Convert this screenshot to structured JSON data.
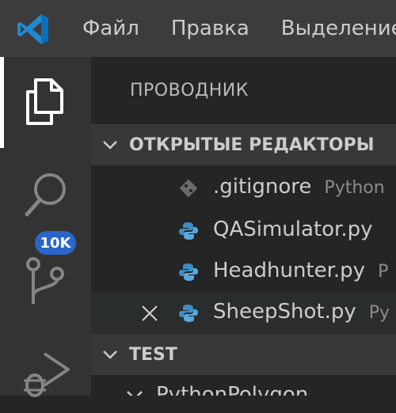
{
  "menu": [
    "Файл",
    "Правка",
    "Выделение"
  ],
  "activity": {
    "items": [
      "explorer-icon",
      "search-icon",
      "source-control-icon",
      "run-debug-icon"
    ],
    "scm_badge": "10K"
  },
  "explorer": {
    "title": "ПРОВОДНИК",
    "open_editors": {
      "label": "ОТКРЫТЫЕ РЕДАКТОРЫ",
      "files": [
        {
          "name": ".gitignore",
          "path": "Python",
          "icon": "git-file-icon"
        },
        {
          "name": "QASimulator.py",
          "path": "",
          "icon": "python-file-icon"
        },
        {
          "name": "Headhunter.py",
          "path": "P",
          "icon": "python-file-icon"
        },
        {
          "name": "SheepShot.py",
          "path": "Py",
          "icon": "python-file-icon"
        }
      ]
    },
    "workspace": {
      "label": "TEST",
      "folder": "PythonPolygon"
    }
  },
  "colors": {
    "titlebar": "#3c3c3c",
    "activitybar": "#333333",
    "sidebar": "#252526",
    "badge": "#2a66c9",
    "python_blue": "#3b8ec6",
    "vscode_blue": "#1f8ad2"
  }
}
